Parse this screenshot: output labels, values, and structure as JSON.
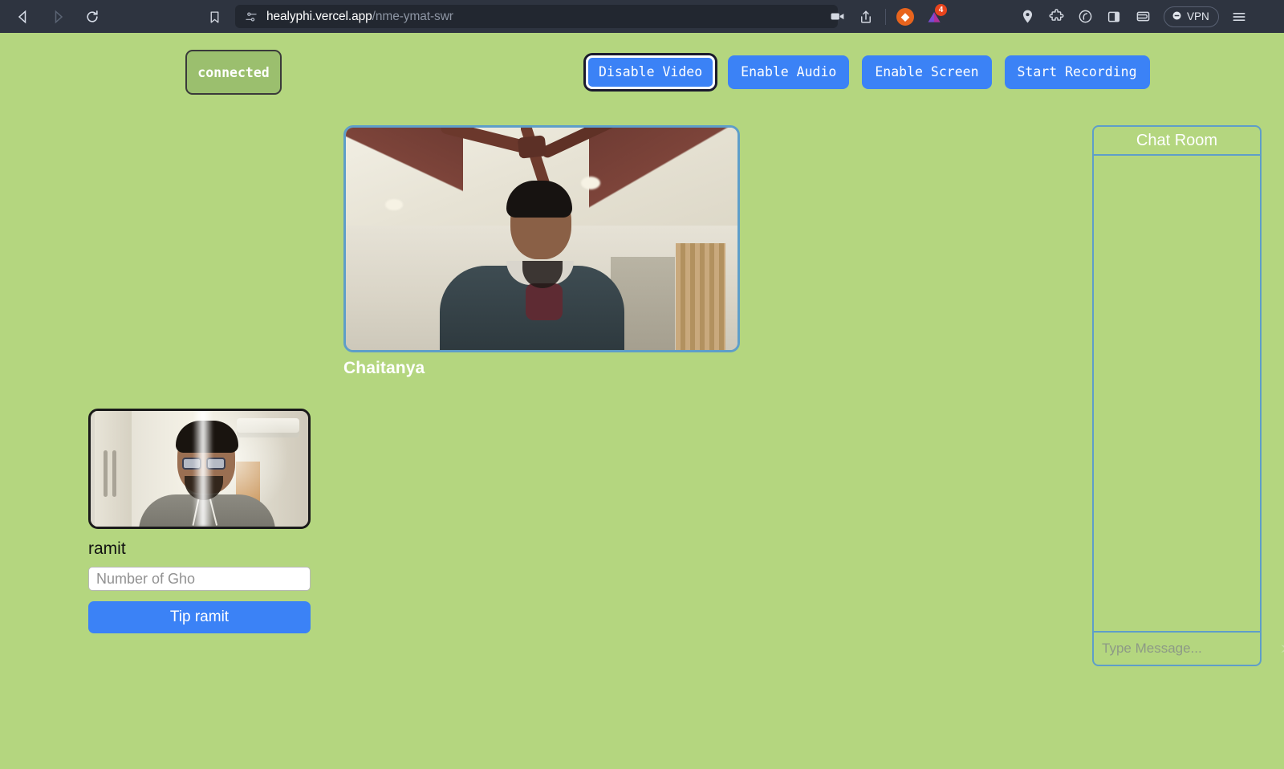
{
  "browser": {
    "back_icon": "back-arrow-icon",
    "forward_icon": "forward-arrow-icon",
    "reload_icon": "reload-icon",
    "bookmark_icon": "bookmark-icon",
    "permission_icon": "site-permissions-icon",
    "url_domain": "healyphi.vercel.app",
    "url_path": "/nme-ymat-swr",
    "camera_icon": "camera-recording-icon",
    "share_icon": "share-icon",
    "brave_icon": "brave-shields-icon",
    "brave_glyph": "◆",
    "extension_icon": "extension-icon",
    "extension_badge": "4",
    "location_icon": "location-pin-icon",
    "puzzle_icon": "extensions-puzzle-icon",
    "leo_icon": "leo-ai-icon",
    "sidebar_icon": "sidebar-panel-icon",
    "wallet_icon": "wallet-icon",
    "vpn_label": "VPN",
    "vpn_icon": "vpn-power-icon",
    "menu_icon": "hamburger-menu-icon"
  },
  "app": {
    "status": "connected",
    "controls": [
      {
        "label": "Disable Video",
        "name": "disable-video-button",
        "focused": true
      },
      {
        "label": "Enable Audio",
        "name": "enable-audio-button",
        "focused": false
      },
      {
        "label": "Enable Screen",
        "name": "enable-screen-button",
        "focused": false
      },
      {
        "label": "Start Recording",
        "name": "start-recording-button",
        "focused": false
      }
    ],
    "main_video": {
      "participant_name": "Chaitanya",
      "label": "remote-video-stream"
    },
    "self_video": {
      "participant_name": "ramit",
      "label": "local-video-stream"
    },
    "tip": {
      "amount_placeholder": "Number of Gho",
      "amount_value": "",
      "button_label": "Tip ramit"
    },
    "chat": {
      "title": "Chat Room",
      "messages": [],
      "input_placeholder": "Type Message...",
      "input_value": "",
      "send_icon": "send-paper-plane-icon",
      "send_glyph": "➢"
    }
  },
  "colors": {
    "page_background": "#b4d67f",
    "browser_chrome": "#2e3440",
    "accent_blue": "#3b82f6",
    "panel_border": "#5e9ec9",
    "status_pill_bg": "#9bbf6e",
    "status_pill_border": "#3a3a3a",
    "thumb_border": "#1a1a1a",
    "badge_red": "#e8441d"
  }
}
